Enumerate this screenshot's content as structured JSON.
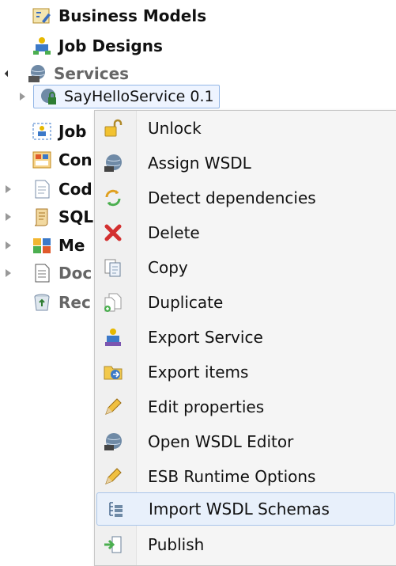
{
  "tree": {
    "items": [
      {
        "label": "Business Models",
        "icon": "business-models-icon",
        "state": "none"
      },
      {
        "label": "Job Designs",
        "icon": "job-designs-icon",
        "state": "none"
      },
      {
        "label": "Services",
        "icon": "services-icon",
        "state": "expanded"
      },
      {
        "label": "SayHelloService 0.1",
        "icon": "service-locked-icon",
        "state": "collapsed",
        "selected": true
      },
      {
        "label": "Job",
        "icon": "joblet-icon",
        "state": "none"
      },
      {
        "label": "Con",
        "icon": "contexts-icon",
        "state": "none"
      },
      {
        "label": "Cod",
        "icon": "code-icon",
        "state": "collapsed"
      },
      {
        "label": "SQL",
        "icon": "sql-templates-icon",
        "state": "collapsed"
      },
      {
        "label": "Me",
        "icon": "metadata-icon",
        "state": "collapsed"
      },
      {
        "label": "Doc",
        "icon": "documentation-icon",
        "state": "collapsed"
      },
      {
        "label": "Rec",
        "icon": "recycle-bin-icon",
        "state": "none"
      }
    ]
  },
  "context_menu": {
    "items": [
      {
        "label": "Unlock",
        "icon": "unlock-icon"
      },
      {
        "label": "Assign WSDL",
        "icon": "wsdl-globe-icon"
      },
      {
        "label": "Detect dependencies",
        "icon": "detect-dependencies-icon"
      },
      {
        "label": "Delete",
        "icon": "delete-icon"
      },
      {
        "label": "Copy",
        "icon": "copy-icon"
      },
      {
        "label": "Duplicate",
        "icon": "duplicate-icon"
      },
      {
        "label": "Export Service",
        "icon": "export-service-icon"
      },
      {
        "label": "Export items",
        "icon": "export-items-icon"
      },
      {
        "label": "Edit properties",
        "icon": "pencil-icon"
      },
      {
        "label": "Open WSDL Editor",
        "icon": "wsdl-globe-icon"
      },
      {
        "label": "ESB Runtime Options",
        "icon": "pencil-icon"
      },
      {
        "label": "Import WSDL Schemas",
        "icon": "import-schemas-icon",
        "highlighted": true
      },
      {
        "label": "Publish",
        "icon": "publish-icon"
      }
    ]
  }
}
